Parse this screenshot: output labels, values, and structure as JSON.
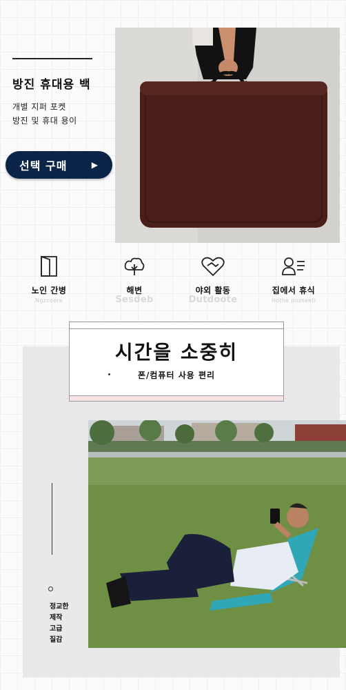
{
  "product": {
    "title": "방진 휴대용 백",
    "subtitle_line1": "개별 지퍼 포켓",
    "subtitle_line2": "방진 및 휴대 용이",
    "buy_button": "선택 구매",
    "buy_arrow": "▶"
  },
  "features": [
    {
      "icon": "door-icon",
      "label": "노인 간병",
      "en": "Ngzcoere"
    },
    {
      "icon": "tree-icon",
      "label": "해변",
      "en": "Sesdeb"
    },
    {
      "icon": "heart-handshake-icon",
      "label": "야외 활동",
      "en": "Dutdoote"
    },
    {
      "icon": "person-list-icon",
      "label": "집에서 휴식",
      "en": "Hothe pozseeti"
    }
  ],
  "banner": {
    "headline": "시간을 소중히",
    "tagline": "폰/컴퓨터 사용 편리"
  },
  "side_caption": [
    "정교한",
    "제작",
    "고급",
    "질감"
  ],
  "colors": {
    "button_bg": "#0c2447",
    "bag_brown": "#4a1f1a",
    "panel_gray": "#e9e9eb"
  }
}
